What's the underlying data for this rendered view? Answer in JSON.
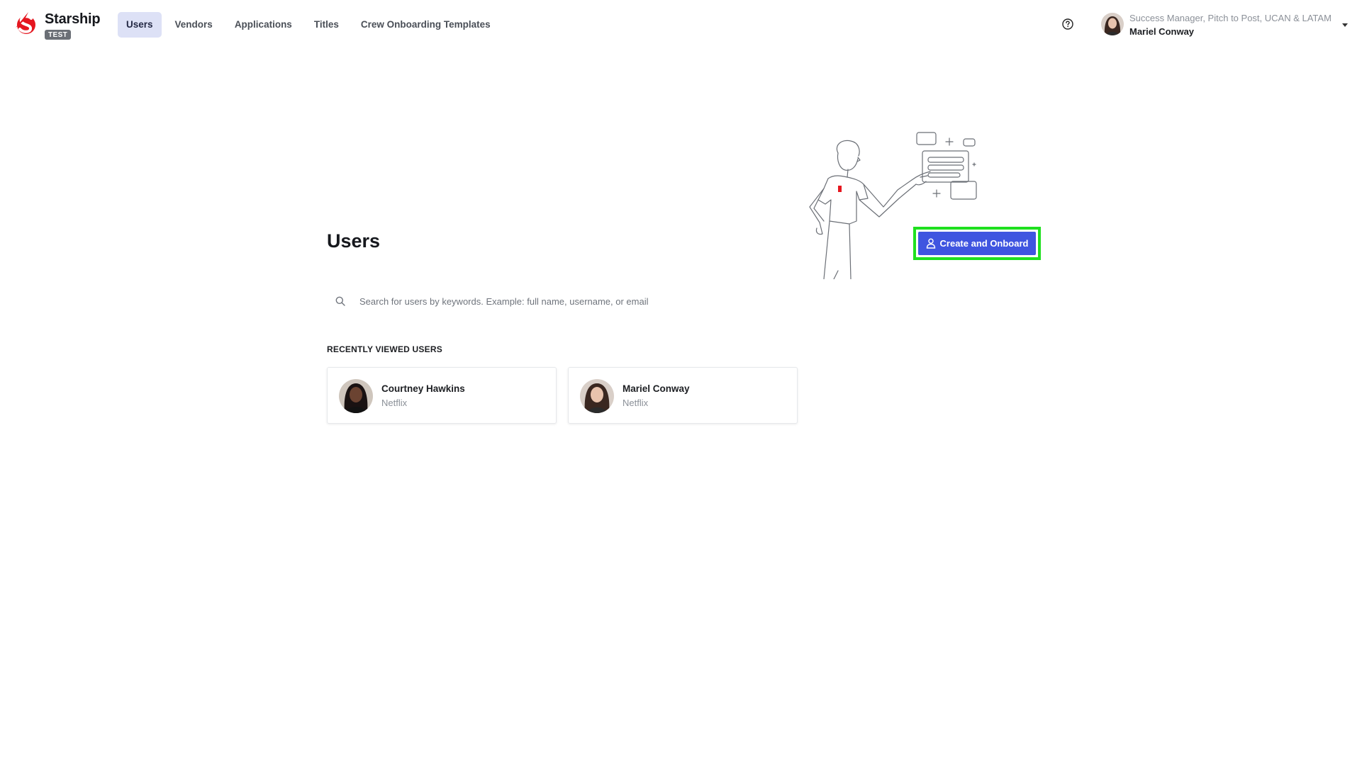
{
  "brand": {
    "name": "Starship",
    "env_badge": "TEST",
    "color": "#e5161f"
  },
  "nav": {
    "items": [
      {
        "label": "Users",
        "active": true
      },
      {
        "label": "Vendors",
        "active": false
      },
      {
        "label": "Applications",
        "active": false
      },
      {
        "label": "Titles",
        "active": false
      },
      {
        "label": "Crew Onboarding Templates",
        "active": false
      }
    ]
  },
  "header": {
    "help_icon": "question-circle-icon",
    "account": {
      "role": "Success Manager, Pitch to Post, UCAN & LATAM",
      "name": "Mariel Conway",
      "dropdown_icon": "caret-down-icon"
    }
  },
  "main": {
    "title": "Users",
    "create_button": {
      "label": "Create and Onboard",
      "icon": "user-icon",
      "color": "#3f55e0",
      "highlight_color": "#1fe01f"
    },
    "search": {
      "placeholder": "Search for users by keywords. Example: full name, username, or email",
      "value": ""
    },
    "recent": {
      "label": "RECENTLY VIEWED USERS",
      "users": [
        {
          "name": "Courtney Hawkins",
          "org": "Netflix"
        },
        {
          "name": "Mariel Conway",
          "org": "Netflix"
        }
      ]
    }
  }
}
